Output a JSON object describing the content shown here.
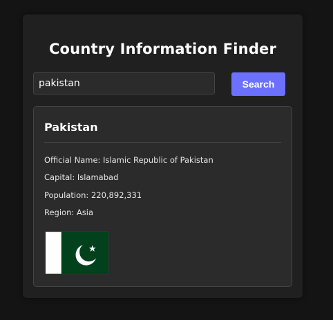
{
  "app": {
    "title": "Country Information Finder"
  },
  "search": {
    "value": "pakistan",
    "button_label": "Search"
  },
  "result": {
    "name": "Pakistan",
    "official_name_line": "Official Name: Islamic Republic of Pakistan",
    "capital_line": "Capital: Islamabad",
    "population_line": "Population: 220,892,331",
    "region_line": "Region: Asia",
    "flag_icon": "pakistan-flag",
    "flag_colors": {
      "green": "#01411c",
      "white": "#ffffff"
    }
  },
  "colors": {
    "accent": "#6b70ff",
    "background": "#141414",
    "panel": "#202020",
    "card": "#2b2b2b"
  }
}
